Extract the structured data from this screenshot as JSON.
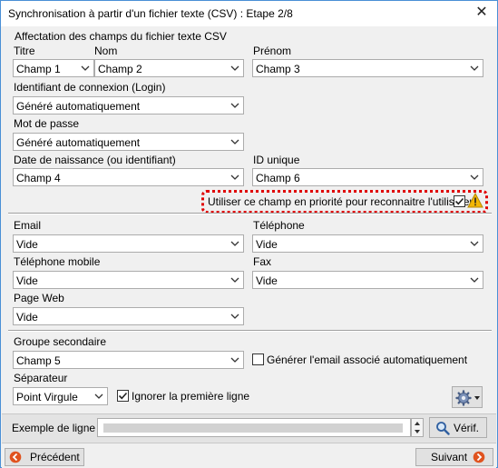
{
  "window": {
    "title": "Synchronisation à partir d'un fichier texte (CSV) : Etape 2/8",
    "close_glyph": "✕"
  },
  "group": {
    "title": "Affectation des champs du fichier texte CSV"
  },
  "fields": {
    "titre": {
      "label": "Titre",
      "value": "Champ 1"
    },
    "nom": {
      "label": "Nom",
      "value": "Champ 2"
    },
    "prenom": {
      "label": "Prénom",
      "value": "Champ 3"
    },
    "login": {
      "label": "Identifiant de connexion (Login)",
      "value": "Généré automatiquement"
    },
    "password": {
      "label": "Mot de passe",
      "value": "Généré automatiquement"
    },
    "birthdate": {
      "label": "Date de naissance (ou identifiant)",
      "value": "Champ 4"
    },
    "unique_id": {
      "label": "ID unique",
      "value": "Champ 6"
    },
    "email": {
      "label": "Email",
      "value": "Vide"
    },
    "telephone": {
      "label": "Téléphone",
      "value": "Vide"
    },
    "mobile": {
      "label": "Téléphone mobile",
      "value": "Vide"
    },
    "fax": {
      "label": "Fax",
      "value": "Vide"
    },
    "web": {
      "label": "Page Web",
      "value": "Vide"
    },
    "group2": {
      "label": "Groupe secondaire",
      "value": "Champ 5"
    },
    "separator": {
      "label": "Séparateur",
      "value": "Point Virgule"
    }
  },
  "checks": {
    "priority": {
      "label": "Utiliser ce champ en priorité pour reconnaitre l'utilisateur",
      "checked": true
    },
    "gen_email": {
      "label": "Générer l'email associé automatiquement",
      "checked": false
    },
    "ignore_first": {
      "label": "Ignorer la première ligne",
      "checked": true
    }
  },
  "example": {
    "label": "Exemple de ligne :",
    "verify_label": "Vérif."
  },
  "nav": {
    "prev_label": "Précédent",
    "next_label": "Suivant"
  },
  "colors": {
    "accent": "#4a8fd6",
    "warning": "#f2b705",
    "highlight": "#e00000",
    "nav_icon": "#e0531f"
  }
}
